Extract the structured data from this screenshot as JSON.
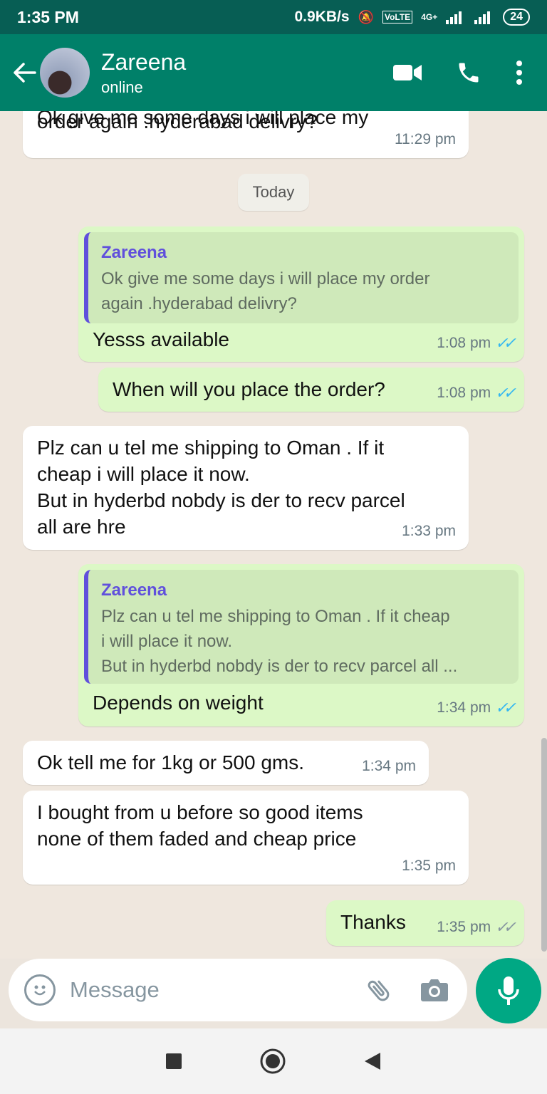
{
  "status_bar": {
    "time": "1:35 PM",
    "net_speed": "0.9KB/s",
    "network": "4G+",
    "battery": "24"
  },
  "header": {
    "contact_name": "Zareena",
    "status": "online"
  },
  "day_divider": "Today",
  "messages": [
    {
      "dir": "in",
      "text": "Ok give me some days i will place my order again .hyderabad delivry?",
      "visible_lines": [
        "order again .hyderabad delivry?"
      ],
      "time": "11:29 pm"
    },
    {
      "dir": "out",
      "quote_name": "Zareena",
      "quote_lines": [
        "Ok give me some days i will place my order",
        "again .hyderabad delivry?"
      ],
      "text": "Yesss available",
      "time": "1:08 pm",
      "status": "read"
    },
    {
      "dir": "out",
      "text": "When will you place the order?",
      "time": "1:08 pm",
      "status": "read"
    },
    {
      "dir": "in",
      "lines": [
        "Plz can u tel me shipping to Oman . If it",
        "cheap i will place it now.",
        "But in hyderbd nobdy is der to recv parcel",
        "all are hre"
      ],
      "time": "1:33 pm"
    },
    {
      "dir": "out",
      "quote_name": "Zareena",
      "quote_lines": [
        "Plz can u tel me shipping to Oman . If it cheap",
        "i will place it now.",
        "But in hyderbd nobdy is der to recv parcel all ..."
      ],
      "text": "Depends on weight",
      "time": "1:34 pm",
      "status": "read"
    },
    {
      "dir": "in",
      "text": "Ok tell me for 1kg or 500 gms.",
      "time": "1:34 pm"
    },
    {
      "dir": "in",
      "lines": [
        "I bought from u before so good items",
        "none of them faded and cheap price"
      ],
      "time": "1:35 pm"
    },
    {
      "dir": "out",
      "text": "Thanks",
      "time": "1:35 pm",
      "status": "delivered"
    }
  ],
  "composer": {
    "placeholder": "Message"
  },
  "icons": [
    "back-arrow-icon",
    "video-call-icon",
    "voice-call-icon",
    "more-options-icon",
    "emoji-icon",
    "attach-icon",
    "camera-icon",
    "mic-icon"
  ],
  "colors": {
    "header": "#008069",
    "status_bar": "#075e54",
    "outgoing_bubble": "#dcf8c6",
    "incoming_bubble": "#ffffff",
    "read_ticks": "#34b7f1",
    "accent": "#00a884",
    "quote_name": "#6050dc"
  }
}
